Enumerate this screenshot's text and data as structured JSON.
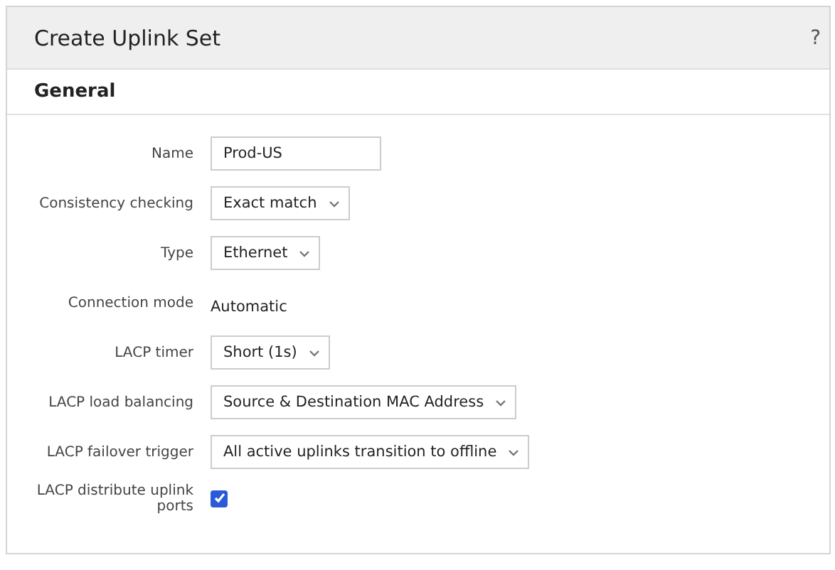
{
  "window": {
    "title": "Create Uplink Set",
    "help": "?"
  },
  "section": {
    "title": "General"
  },
  "fields": [
    {
      "kind": "text",
      "label": "Name",
      "value": "Prod-US"
    },
    {
      "kind": "select",
      "label": "Consistency checking",
      "value": "Exact match"
    },
    {
      "kind": "select",
      "label": "Type",
      "value": "Ethernet"
    },
    {
      "kind": "static",
      "label": "Connection mode",
      "value": "Automatic"
    },
    {
      "kind": "select",
      "label": "LACP timer",
      "value": "Short (1s)"
    },
    {
      "kind": "select",
      "label": "LACP load balancing",
      "value": "Source & Destination MAC Address"
    },
    {
      "kind": "select",
      "label": "LACP failover trigger",
      "value": "All active uplinks transition to offline"
    },
    {
      "kind": "checkbox",
      "label": "LACP distribute uplink ports",
      "checked": true
    }
  ]
}
